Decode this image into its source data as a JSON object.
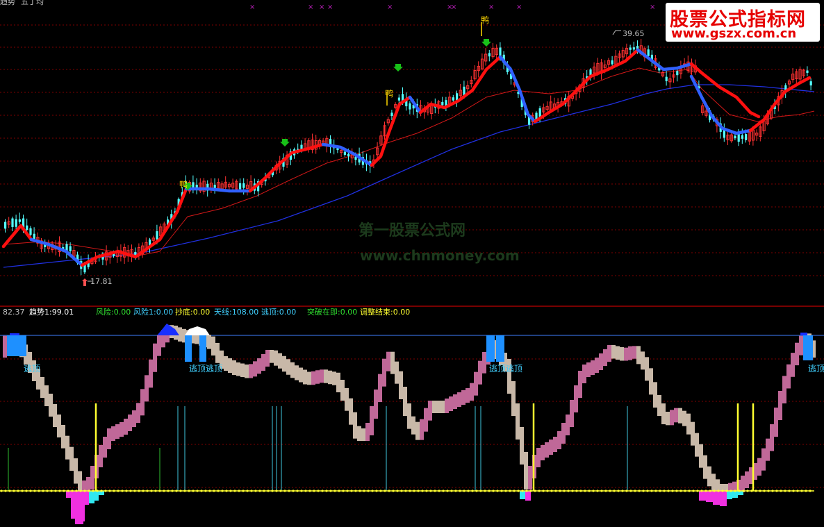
{
  "header": {
    "left_fragment": "趋势",
    "ticker_fragment": "五丁均",
    "markers": [
      "×",
      "×",
      "×",
      "×",
      "×",
      "×",
      "×",
      "×",
      "×",
      "×"
    ]
  },
  "price_panel": {
    "high_label": "39.65",
    "low_label": "17.81",
    "duck_label": "鸭",
    "colors": {
      "up": "#ff3232",
      "down": "#54ffff",
      "ma_red": "#d01818",
      "ma_blue": "#2030e0",
      "trend_up": "#ff1010",
      "trend_down": "#3060ff",
      "buy_arrow": "#18c018",
      "grid": "#800000"
    }
  },
  "indicator_bar": {
    "items": [
      {
        "text": "82.37",
        "color": "#c0c0c0"
      },
      {
        "text": "趋势1:99.01",
        "color": "#ffffff"
      },
      {
        "text": "风险:0.00",
        "color": "#30e030"
      },
      {
        "text": "风险1:0.00",
        "color": "#40d0ff"
      },
      {
        "text": "抄底:0.00",
        "color": "#ffff30"
      },
      {
        "text": "天线:108.00",
        "color": "#40d0ff"
      },
      {
        "text": "逃顶:0.00",
        "color": "#40d0ff"
      },
      {
        "text": "突破在即:0.00",
        "color": "#30e030"
      },
      {
        "text": "调整结束:0.00",
        "color": "#ffff30"
      }
    ]
  },
  "signals": {
    "escape_label": "逃顶",
    "escape_labels": [
      "逃顶",
      "逃顶逃顶",
      "逃顶逃顶",
      "逃顶"
    ]
  },
  "watermarks": {
    "brand_title": "股票公式指标网",
    "brand_url": "www.gszx.com.cn",
    "faint_title": "第一股票公式网",
    "faint_url": "www.chnmoney.com"
  }
}
